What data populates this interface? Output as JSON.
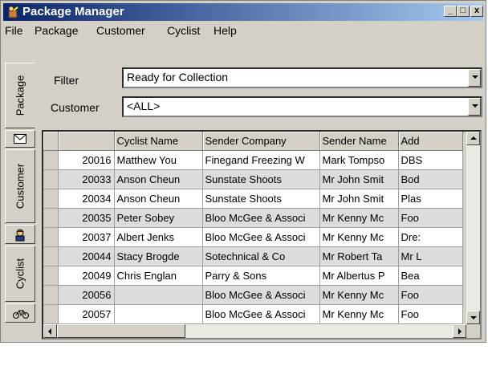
{
  "window": {
    "title": "Package Manager",
    "minimize_label": "_",
    "maximize_label": "□",
    "close_label": "x",
    "icon": "package-manager-icon"
  },
  "menu": [
    "File",
    "Package",
    "Customer",
    "Cyclist",
    "Help"
  ],
  "side_tabs": [
    {
      "label": "Package",
      "icon": "envelope-icon"
    },
    {
      "label": "Customer",
      "icon": "person-icon"
    },
    {
      "label": "Cyclist",
      "icon": "bicycle-icon"
    }
  ],
  "filter": {
    "label": "Filter",
    "value": "Ready for Collection"
  },
  "customer": {
    "label": "Customer",
    "value": "<ALL>"
  },
  "table": {
    "columns": [
      "",
      "Cyclist Name",
      "Sender Company",
      "Sender Name",
      "Add"
    ],
    "rows": [
      [
        "20016",
        "Matthew You",
        "Finegand Freezing W",
        "Mark Tompso",
        "DBS"
      ],
      [
        "20033",
        "Anson Cheun",
        "Sunstate Shoots",
        "Mr John Smit",
        "Bod"
      ],
      [
        "20034",
        "Anson Cheun",
        "Sunstate Shoots",
        "Mr John Smit",
        "Plas"
      ],
      [
        "20035",
        "Peter Sobey",
        "Bloo McGee & Associ",
        "Mr Kenny Mc",
        "Foo"
      ],
      [
        "20037",
        "Albert Jenks",
        "Bloo McGee & Associ",
        "Mr Kenny Mc",
        "Dre:"
      ],
      [
        "20044",
        "Stacy Brogde",
        "Sotechnical & Co",
        "Mr Robert Ta",
        "Mr L"
      ],
      [
        "20049",
        "Chris Englan",
        "Parry & Sons",
        "Mr Albertus P",
        "Bea"
      ],
      [
        "20056",
        "",
        "Bloo McGee & Associ",
        "Mr Kenny Mc",
        "Foo"
      ],
      [
        "20057",
        "",
        "Bloo McGee & Associ",
        "Mr Kenny Mc",
        "Foo"
      ]
    ]
  },
  "colors": {
    "title_start": "#0a246a",
    "title_end": "#a6caf0",
    "face": "#d4d0c8",
    "alt_row": "#dcdcdc"
  }
}
